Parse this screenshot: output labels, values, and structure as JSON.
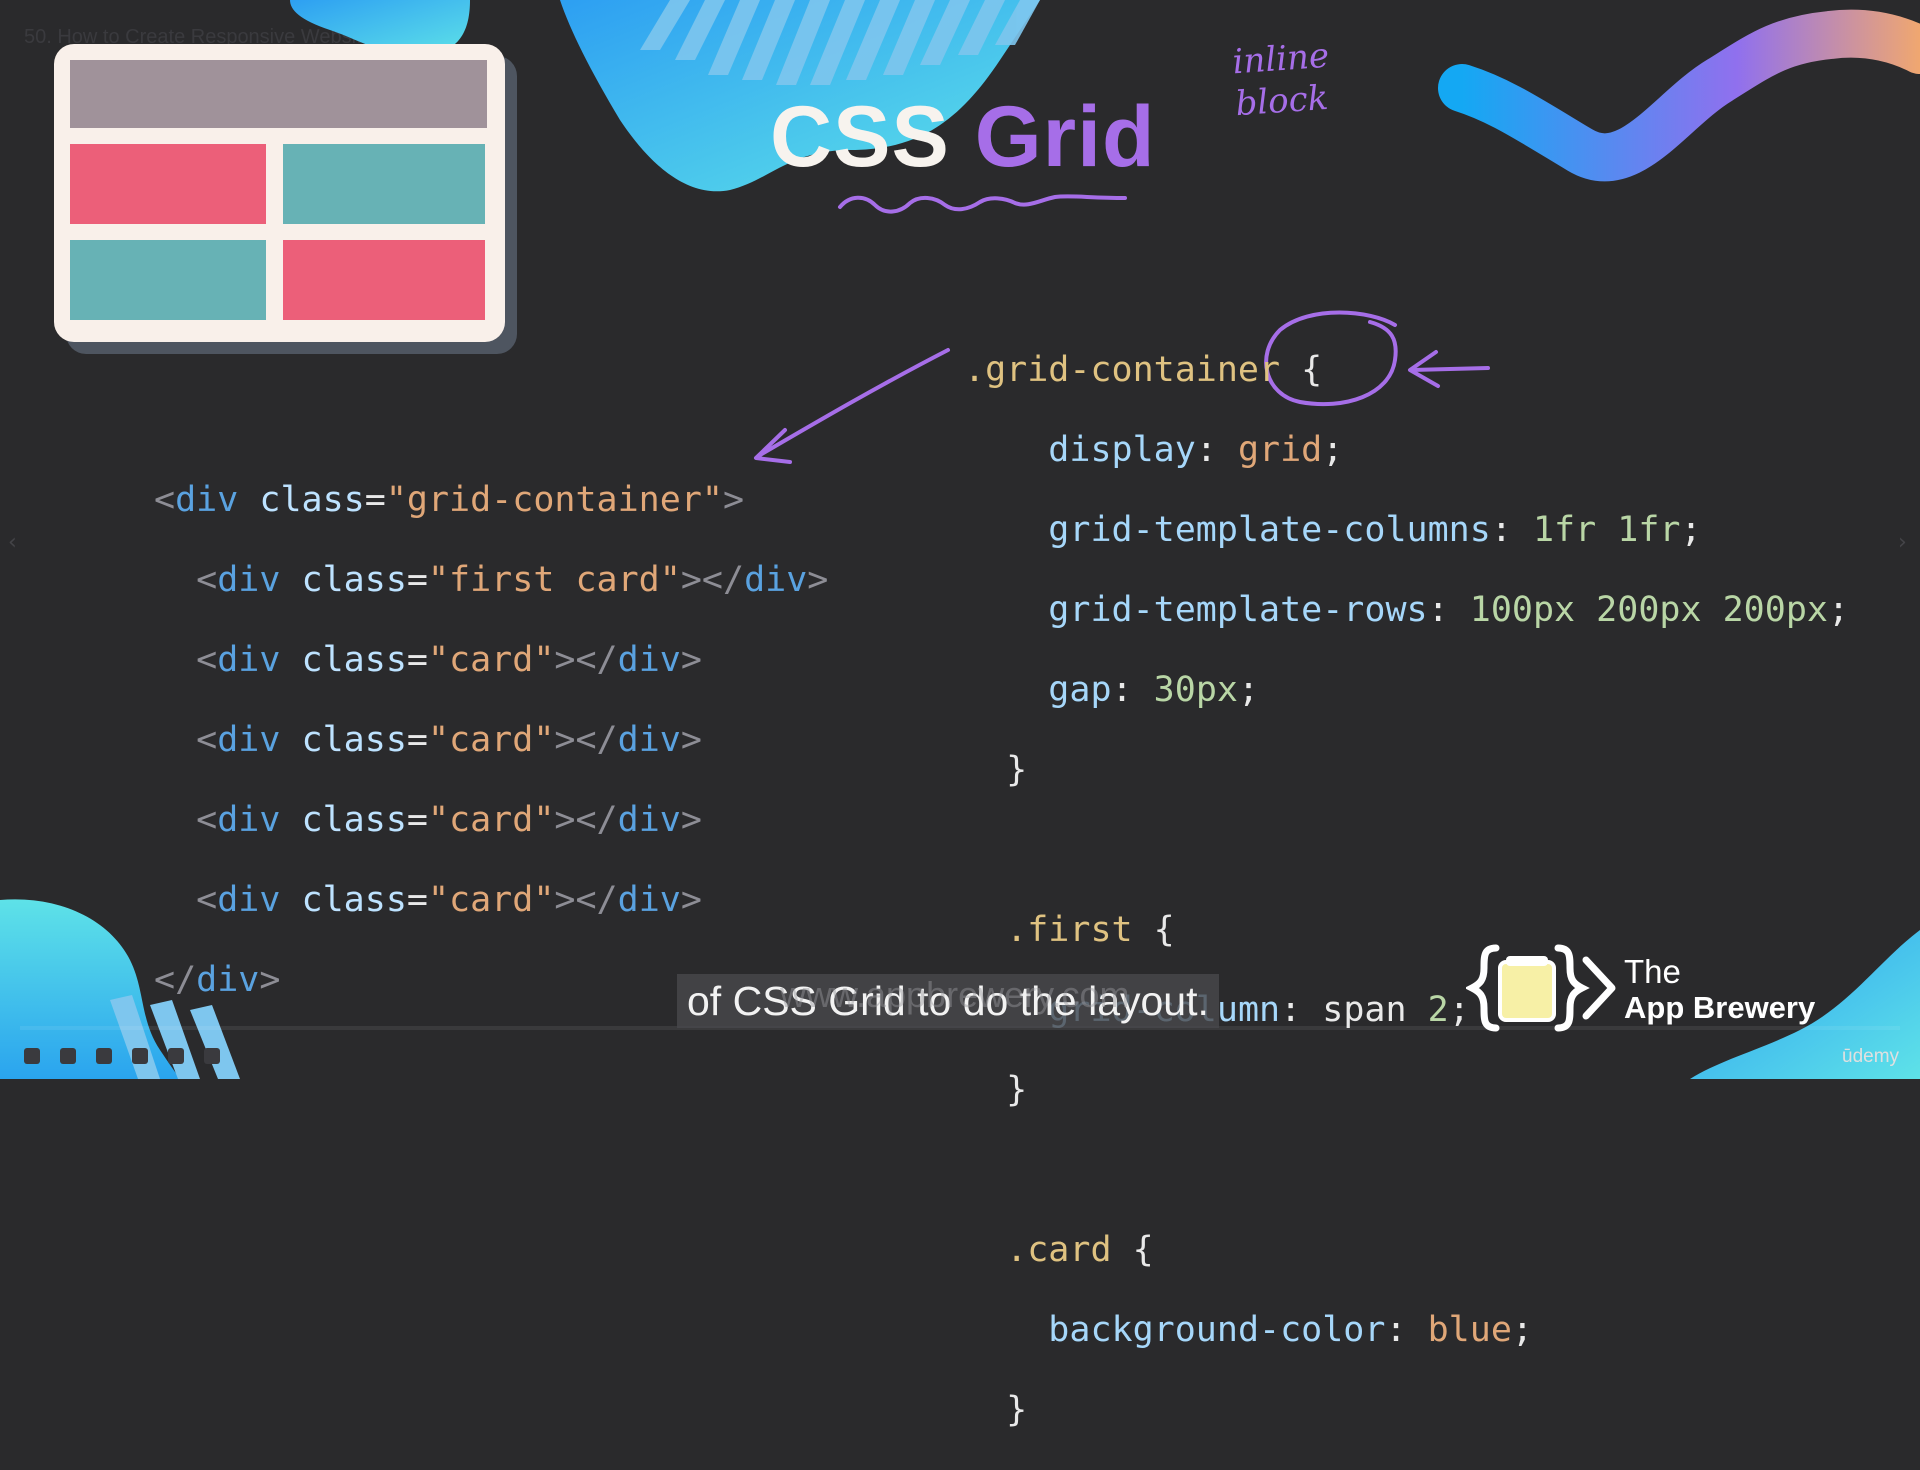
{
  "video": {
    "title": "50. How to Create Responsive Websites"
  },
  "slide": {
    "title_part1": "CSS",
    "title_part2": "Grid",
    "annotation_line1": "inline",
    "annotation_line2": "block"
  },
  "html_code": {
    "line1": {
      "open": "<",
      "tag": "div",
      "attr": "class",
      "eq": "=",
      "str": "\"grid-container\"",
      "close": ">"
    },
    "line2": {
      "open": "<",
      "tag": "div",
      "attr": "class",
      "eq": "=",
      "str": "\"first card\"",
      "mid": "></",
      "tag2": "div",
      "close": ">"
    },
    "card_lines": [
      {
        "open": "<",
        "tag": "div",
        "attr": "class",
        "eq": "=",
        "str": "\"card\"",
        "mid": "></",
        "tag2": "div",
        "close": ">"
      },
      {
        "open": "<",
        "tag": "div",
        "attr": "class",
        "eq": "=",
        "str": "\"card\"",
        "mid": "></",
        "tag2": "div",
        "close": ">"
      },
      {
        "open": "<",
        "tag": "div",
        "attr": "class",
        "eq": "=",
        "str": "\"card\"",
        "mid": "></",
        "tag2": "div",
        "close": ">"
      },
      {
        "open": "<",
        "tag": "div",
        "attr": "class",
        "eq": "=",
        "str": "\"card\"",
        "mid": "></",
        "tag2": "div",
        "close": ">"
      }
    ],
    "last": {
      "open": "</",
      "tag": "div",
      "close": ">"
    }
  },
  "css_code": {
    "grid_container": {
      "selector": ".grid-container",
      "brace_open": " {",
      "decls": [
        {
          "prop": "display",
          "colon": ": ",
          "val": "grid",
          "semi": ";"
        },
        {
          "prop": "grid-template-columns",
          "colon": ": ",
          "val": "1fr 1fr",
          "semi": ";"
        },
        {
          "prop": "grid-template-rows",
          "colon": ": ",
          "val": "100px 200px 200px",
          "semi": ";"
        },
        {
          "prop": "gap",
          "colon": ": ",
          "val": "30px",
          "semi": ";"
        }
      ],
      "brace_close": "}"
    },
    "first": {
      "selector": ".first",
      "brace_open": " {",
      "decl": {
        "prop": "grid-column",
        "colon": ": ",
        "val_word": "span ",
        "val_num": "2",
        "semi": ";"
      },
      "brace_close": "}"
    },
    "card": {
      "selector": ".card",
      "brace_open": " {",
      "decl": {
        "prop": "background-color",
        "colon": ": ",
        "val": "blue",
        "semi": ";"
      },
      "brace_close": "}"
    }
  },
  "caption": {
    "text": "of CSS Grid to do the layout.",
    "watermark": "www.appbrewery.com"
  },
  "brand": {
    "line1": "The",
    "line2": "App Brewery"
  },
  "platform": {
    "name": "ūdemy"
  },
  "navigation": {
    "prev_icon": "‹",
    "next_icon": "›"
  },
  "colors": {
    "background": "#2a2a2c",
    "accent_purple": "#a66ee8",
    "cell_header": "#a0929a",
    "cell_pink": "#ec5f79",
    "cell_teal": "#67b2b5",
    "frame": "#f9f0ea"
  }
}
